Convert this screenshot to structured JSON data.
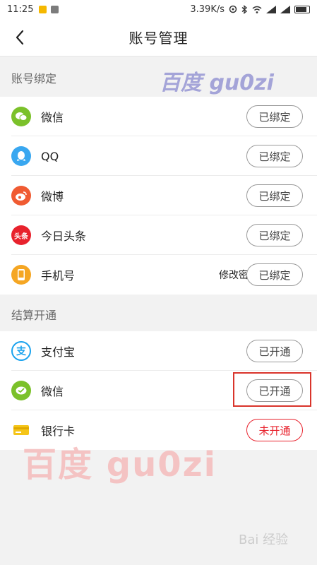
{
  "status_bar": {
    "time": "11:25",
    "speed": "3.39K/s"
  },
  "nav": {
    "title": "账号管理"
  },
  "sections": [
    {
      "header": "账号绑定",
      "rows": [
        {
          "icon": "wechat-icon",
          "label": "微信",
          "button": "已绑定"
        },
        {
          "icon": "qq-icon",
          "label": "QQ",
          "button": "已绑定"
        },
        {
          "icon": "weibo-icon",
          "label": "微博",
          "button": "已绑定"
        },
        {
          "icon": "toutiao-icon",
          "label": "今日头条",
          "button": "已绑定"
        },
        {
          "icon": "phone-icon",
          "label": "手机号",
          "extra": "修改密码",
          "button": "已绑定"
        }
      ]
    },
    {
      "header": "结算开通",
      "rows": [
        {
          "icon": "alipay-icon",
          "label": "支付宝",
          "button": "已开通"
        },
        {
          "icon": "wechat-pay-icon",
          "label": "微信",
          "button": "已开通"
        },
        {
          "icon": "bank-card-icon",
          "label": "银行卡",
          "button": "未开通"
        }
      ]
    }
  ],
  "icon_text": {
    "toutiao": "头条"
  },
  "watermark": {
    "top": "百度 gu0zi",
    "bottom": "百度  gu0zi",
    "corner": "Bai 经验"
  },
  "colors": {
    "wechat": "#7bc12a",
    "qq": "#39a7f0",
    "weibo": "#f05b32",
    "toutiao": "#e8222d",
    "phone": "#f5a623",
    "alipay": "#1aa3ee",
    "bank": "#f5c518",
    "danger": "#e8222d"
  }
}
